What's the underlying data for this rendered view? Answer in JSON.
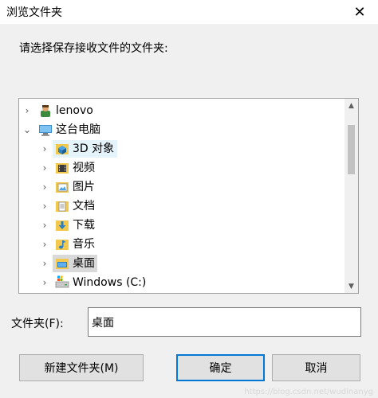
{
  "window": {
    "title": "浏览文件夹",
    "close_glyph": "✕"
  },
  "instruction": "请选择保存接收文件的文件夹:",
  "tree": {
    "items": [
      {
        "label": "lenovo",
        "icon": "user-icon",
        "expander": "›"
      },
      {
        "label": "这台电脑",
        "icon": "computer-icon",
        "expander": "⌄"
      },
      {
        "label": "3D 对象",
        "icon": "3d-objects-icon",
        "expander": "›"
      },
      {
        "label": "视频",
        "icon": "videos-icon",
        "expander": "›"
      },
      {
        "label": "图片",
        "icon": "pictures-icon",
        "expander": "›"
      },
      {
        "label": "文档",
        "icon": "documents-icon",
        "expander": "›"
      },
      {
        "label": "下载",
        "icon": "downloads-icon",
        "expander": "›"
      },
      {
        "label": "音乐",
        "icon": "music-icon",
        "expander": "›"
      },
      {
        "label": "桌面",
        "icon": "desktop-icon",
        "expander": "›"
      },
      {
        "label": "Windows (C:)",
        "icon": "drive-icon",
        "expander": "›"
      }
    ],
    "scroll_up": "▲",
    "scroll_down": "▼"
  },
  "folder_field": {
    "label": "文件夹(F):",
    "value": "桌面"
  },
  "buttons": {
    "new_folder": "新建文件夹(M)",
    "ok": "确定",
    "cancel": "取消"
  },
  "watermark": "https://blog.csdn.net/wudinanyg",
  "colors": {
    "accent": "#0078d7",
    "hover_bg": "#e5f3fb",
    "selected_bg": "#d9d9d9"
  }
}
